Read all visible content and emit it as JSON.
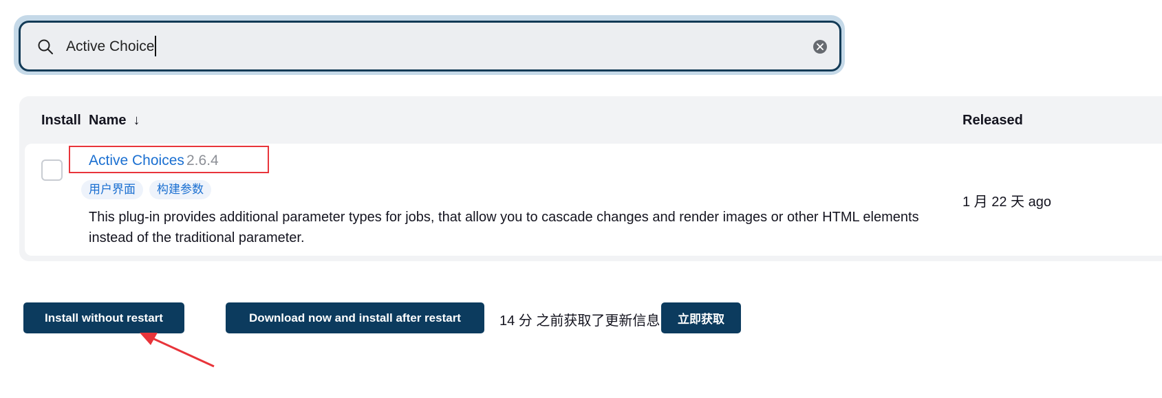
{
  "search": {
    "value": "Active Choice",
    "icon": "search-icon",
    "clear_icon": "clear-circle-icon"
  },
  "table": {
    "headers": {
      "install": "Install",
      "name": "Name",
      "sort_indicator": "↓",
      "released": "Released"
    },
    "rows": [
      {
        "name": "Active Choices",
        "version": "2.6.4",
        "tags": [
          "用户界面",
          "构建参数"
        ],
        "description": "This plug-in provides additional parameter types for jobs, that allow you to cascade changes and render images or other HTML elements instead of the traditional parameter.",
        "released": "1 月 22 天 ago",
        "checked": false
      }
    ]
  },
  "actions": {
    "install_without_restart": "Install without restart",
    "download_install_after_restart": "Download now and install after restart",
    "update_info": "14 分 之前获取了更新信息",
    "fetch_now": "立即获取"
  },
  "colors": {
    "primary_button": "#0c3b5e",
    "link": "#1a6fd1",
    "annotation": "#e8343a"
  }
}
